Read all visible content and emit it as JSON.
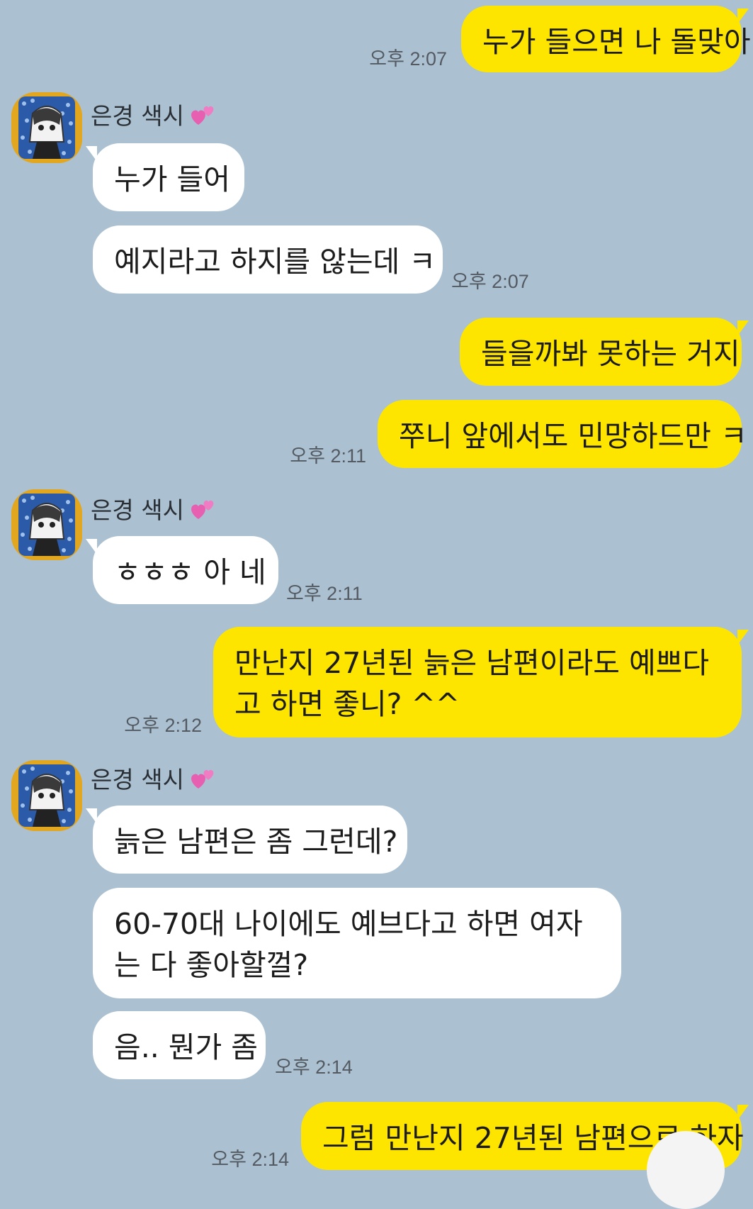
{
  "chat": {
    "contact_name": "은경 색시",
    "contact_emoji": "💕",
    "colors": {
      "background": "#abc1d1",
      "sent_bubble": "#fee500",
      "received_bubble": "#ffffff",
      "timestamp": "#545a62"
    },
    "messages": [
      {
        "id": "m1",
        "side": "sent",
        "text": "누가 들으면 나 돌맞아",
        "time": "오후 2:07"
      },
      {
        "id": "m2",
        "side": "received",
        "text": "누가 들어",
        "time": ""
      },
      {
        "id": "m3",
        "side": "received",
        "text": "예지라고 하지를 않는데 ㅋ",
        "time": "오후 2:07"
      },
      {
        "id": "m4",
        "side": "sent",
        "text": "들을까봐 못하는 거지",
        "time": ""
      },
      {
        "id": "m5",
        "side": "sent",
        "text": "쭈니 앞에서도 민망하드만 ㅋ",
        "time": "오후 2:11"
      },
      {
        "id": "m6",
        "side": "received",
        "text": "ㅎㅎㅎ 아 네",
        "time": "오후 2:11"
      },
      {
        "id": "m7",
        "side": "sent",
        "text": "만난지 27년된 늙은 남편이라도 예쁘다고 하면 좋니? ^^",
        "time": "오후 2:12"
      },
      {
        "id": "m8",
        "side": "received",
        "text": "늙은 남편은 좀 그런데?",
        "time": ""
      },
      {
        "id": "m9",
        "side": "received",
        "text": "60-70대 나이에도 예브다고 하면 여자는 다 좋아할껄?",
        "time": ""
      },
      {
        "id": "m10",
        "side": "received",
        "text": "음.. 뭔가 좀",
        "time": "오후 2:14"
      },
      {
        "id": "m11",
        "side": "sent",
        "text": "그럼 만난지 27년된 남편으로 하자",
        "time": "오후 2:14"
      }
    ]
  }
}
